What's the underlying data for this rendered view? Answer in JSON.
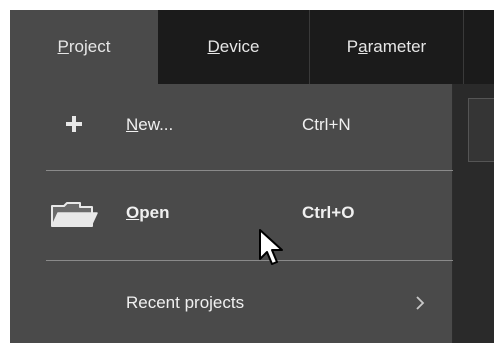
{
  "menubar": {
    "tabs": [
      {
        "accel": "P",
        "rest": "roject"
      },
      {
        "accel": "D",
        "rest": "evice"
      },
      {
        "pre": "P",
        "accel": "a",
        "rest": "rameter"
      }
    ]
  },
  "dropdown": {
    "items": [
      {
        "accel": "N",
        "rest": "ew...",
        "shortcut": "Ctrl+N",
        "icon": "plus-icon"
      },
      {
        "accel": "O",
        "rest": "pen",
        "shortcut": "Ctrl+O",
        "icon": "folder-icon"
      },
      {
        "label": "Recent projects",
        "icon": "chevron-right-icon"
      }
    ]
  },
  "colors": {
    "menubar": "#1b1b1b",
    "menu_bg": "#4a4a4a",
    "text": "#f0f0f0"
  }
}
